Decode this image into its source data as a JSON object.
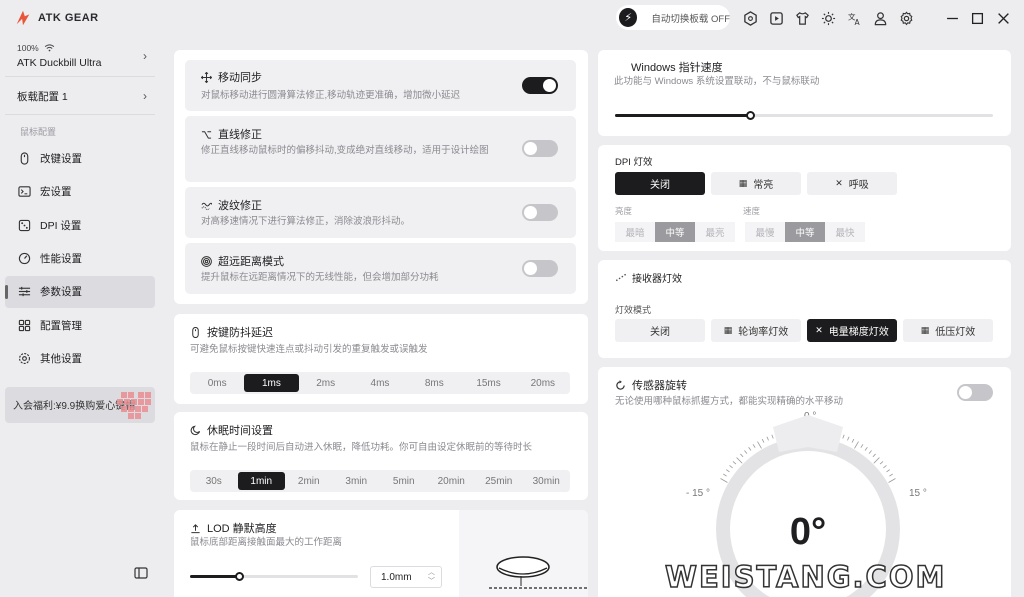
{
  "app": {
    "brand": "ATK GEAR"
  },
  "titlebar": {
    "auto_switch_label": "自动切换板载 OFF"
  },
  "device": {
    "battery": "100%",
    "name": "ATK Duckbill Ultra"
  },
  "profile": {
    "label": "板载配置 1"
  },
  "sidebar": {
    "section_label": "鼠标配置",
    "items": [
      {
        "label": "改键设置",
        "icon": "mouse-icon"
      },
      {
        "label": "宏设置",
        "icon": "terminal-icon"
      },
      {
        "label": "DPI 设置",
        "icon": "dice-icon"
      },
      {
        "label": "性能设置",
        "icon": "gauge-icon"
      },
      {
        "label": "参数设置",
        "icon": "sliders-icon"
      },
      {
        "label": "配置管理",
        "icon": "grid-icon"
      },
      {
        "label": "其他设置",
        "icon": "gear-icon"
      }
    ],
    "promo": "入会福利:¥9.9换购爱心键帽"
  },
  "features": {
    "motion_sync": {
      "title": "移动同步",
      "desc": "对鼠标移动进行圆滑算法修正,移动轨迹更准确，增加微小延迟",
      "on": true
    },
    "straight": {
      "title": "直线修正",
      "desc": "修正直线移动鼠标时的偏移抖动,变成绝对直线移动，适用于设计绘图",
      "on": false
    },
    "ripple": {
      "title": "波纹修正",
      "desc": "对高移速情况下进行算法修正，消除波浪形抖动。",
      "on": false
    },
    "long_range": {
      "title": "超远距离模式",
      "desc": "提升鼠标在远距离情况下的无线性能，但会增加部分功耗",
      "on": false
    }
  },
  "debounce": {
    "title": "按键防抖延迟",
    "desc": "可避免鼠标按键快速连点或抖动引发的重复触发或误触发",
    "options": [
      "0ms",
      "1ms",
      "2ms",
      "4ms",
      "8ms",
      "15ms",
      "20ms"
    ],
    "selected": 1
  },
  "sleep": {
    "title": "休眠时间设置",
    "desc": "鼠标在静止一段时间后自动进入休眠，降低功耗。你可自由设定休眠前的等待时长",
    "options": [
      "30s",
      "1min",
      "2min",
      "3min",
      "5min",
      "20min",
      "25min",
      "30min"
    ],
    "selected": 1
  },
  "lod": {
    "title": "LOD 静默高度",
    "desc": "鼠标底部距离接触面最大的工作距离",
    "value": "1.0mm",
    "level": 0.3
  },
  "pointer_speed": {
    "title": "Windows 指针速度",
    "desc": "此功能与 Windows 系统设置联动，不与鼠标联动",
    "level": 0.36
  },
  "dpi_light": {
    "title": "DPI 灯效",
    "modes": [
      "关闭",
      "常亮",
      "呼吸"
    ],
    "selected": 0,
    "brightness_label": "亮度",
    "brightness": [
      "最暗",
      "中等",
      "最亮"
    ],
    "speed_label": "速度",
    "speed": [
      "最慢",
      "中等",
      "最快"
    ]
  },
  "receiver_light": {
    "title": "接收器灯效",
    "mode_label": "灯效模式",
    "modes": [
      "关闭",
      "轮询率灯效",
      "电量梯度灯效",
      "低压灯效"
    ],
    "selected": 2
  },
  "sensor": {
    "title": "传感器旋转",
    "desc": "无论使用哪种鼠标抓握方式，都能实现精确的水平移动",
    "on": false,
    "value": "0°",
    "tick_top": "0 °",
    "tick_left": "- 15 °",
    "tick_right": "15 °"
  },
  "watermark": "WEISTANG.COM",
  "colors": {
    "accent": "#1c1c1e",
    "panel": "#ffffff",
    "bg": "#ededf0",
    "logo": "#e8563a"
  }
}
